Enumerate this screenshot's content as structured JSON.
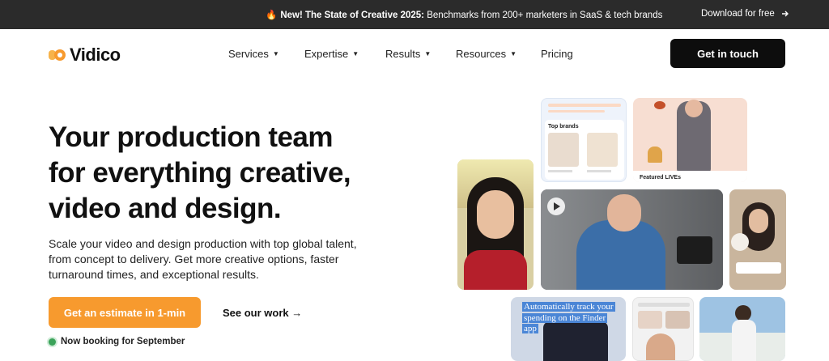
{
  "banner": {
    "prefix": "New! The State of Creative 2025:",
    "text": " Benchmarks from 200+ marketers in SaaS & tech brands",
    "download": "Download for free"
  },
  "logo": {
    "text": "Vidico"
  },
  "nav": {
    "items": [
      {
        "label": "Services"
      },
      {
        "label": "Expertise"
      },
      {
        "label": "Results"
      },
      {
        "label": "Resources"
      },
      {
        "label": "Pricing"
      }
    ],
    "cta": "Get in touch"
  },
  "hero": {
    "heading_line1": "Your production team",
    "heading_line2": "for everything creative,",
    "heading_line3": "video and design.",
    "subtitle": "Scale your video and design production with top global talent, from concept to delivery. Get more creative options, faster turnaround times, and exceptional results.",
    "primary_cta": "Get an estimate in 1-min",
    "secondary_cta": "See our work →",
    "booking": "Now booking for September"
  },
  "collage": {
    "top_brands": "Top brands",
    "featured": "Featured LIVEs",
    "finder_caption": "Automatically track your spending on the Finder app"
  },
  "colors": {
    "accent": "#f79a2e",
    "dark": "#0d0d0d",
    "banner": "#2b2b2b"
  }
}
